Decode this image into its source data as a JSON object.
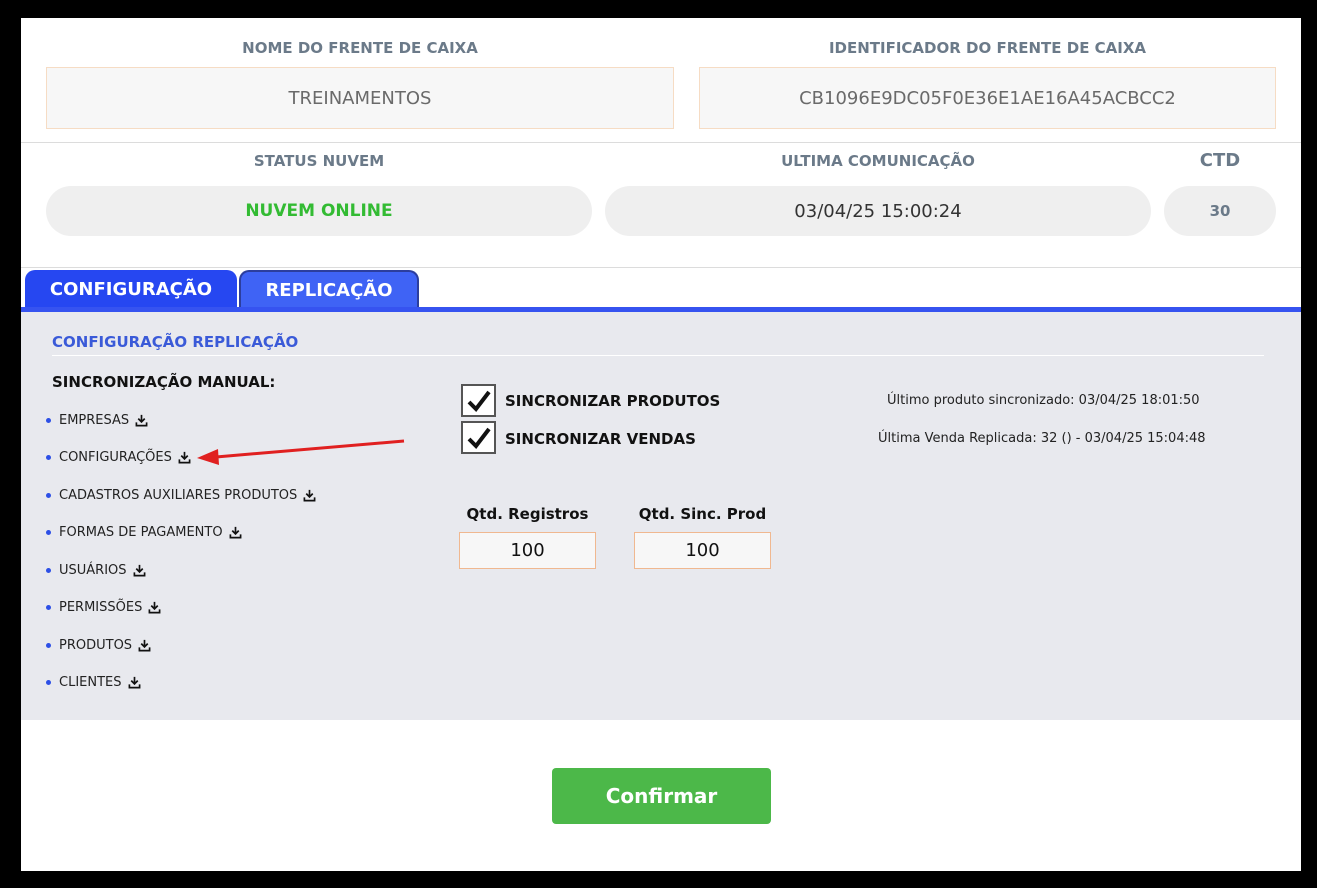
{
  "header": {
    "name_label": "NOME DO FRENTE DE CAIXA",
    "name_value": "TREINAMENTOS",
    "id_label": "IDENTIFICADOR DO FRENTE DE CAIXA",
    "id_value": "CB1096E9DC05F0E36E1AE16A45ACBCC2"
  },
  "status": {
    "cloud_label": "STATUS NUVEM",
    "cloud_value": "NUVEM ONLINE",
    "cloud_color": "#33bb33",
    "last_comm_label": "ULTIMA COMUNICAÇÃO",
    "last_comm_value": "03/04/25 15:00:24",
    "ctd_label": "CTD",
    "ctd_value": "30"
  },
  "tabs": [
    {
      "label": "CONFIGURAÇÃO"
    },
    {
      "label": "REPLICAÇÃO"
    }
  ],
  "replication": {
    "section_title": "CONFIGURAÇÃO REPLICAÇÃO",
    "manual_sync_title": "SINCRONIZAÇÃO MANUAL:",
    "sync_items": [
      {
        "label": "EMPRESAS",
        "icon": "download-icon"
      },
      {
        "label": "CONFIGURAÇÕES",
        "icon": "download-icon"
      },
      {
        "label": "CADASTROS AUXILIARES PRODUTOS",
        "icon": "download-icon"
      },
      {
        "label": "FORMAS DE PAGAMENTO",
        "icon": "download-icon"
      },
      {
        "label": "USUÁRIOS",
        "icon": "download-icon"
      },
      {
        "label": "PERMISSÕES",
        "icon": "download-icon"
      },
      {
        "label": "PRODUTOS",
        "icon": "download-icon"
      },
      {
        "label": "CLIENTES",
        "icon": "download-icon"
      }
    ],
    "sync_products_label": "SINCRONIZAR PRODUTOS",
    "sync_products_checked": true,
    "sync_sales_label": "SINCRONIZAR VENDAS",
    "sync_sales_checked": true,
    "last_product_info": "Último produto sincronizado: 03/04/25 18:01:50",
    "last_sale_info": "Última Venda Replicada: 32 () - 03/04/25 15:04:48",
    "qtd_registros_label": "Qtd. Registros",
    "qtd_registros_value": "100",
    "qtd_sinc_prod_label": "Qtd. Sinc. Prod",
    "qtd_sinc_prod_value": "100"
  },
  "confirm_label": "Confirmar",
  "annotation": {
    "arrow_color": "#e02020"
  }
}
